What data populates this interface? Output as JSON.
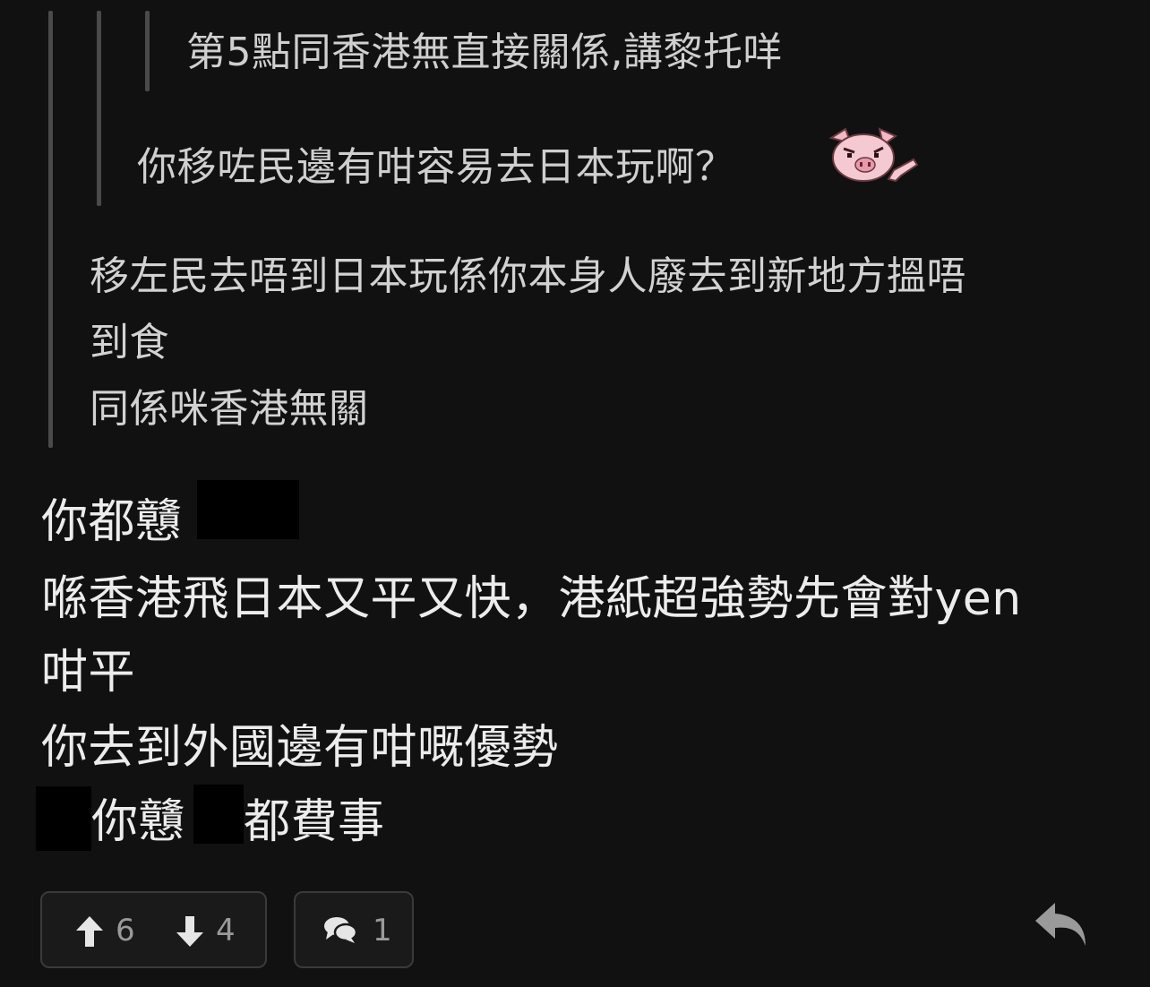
{
  "quotes": {
    "level3_text": "第5點同香港無直接關係,講黎托咩",
    "level2_text": "你移咗民邊有咁容易去日本玩啊？",
    "level2_sticker": "pig-sticker",
    "level1_lines": [
      "移左民去唔到日本玩係你本身人廢去到新地方搵唔",
      "到食",
      "同係咪香港無關"
    ]
  },
  "reply": {
    "line1_prefix": "你都戇",
    "line2": "喺香港飛日本又平又快，港紙超強勢先會對yen",
    "line3": "咁平",
    "line4": "你去到外國邊有咁嘅優勢",
    "line5_part1": "你戇",
    "line5_part2": "都費事"
  },
  "actions": {
    "upvote_count": "6",
    "downvote_count": "4",
    "comment_count": "1",
    "icons": {
      "upvote": "arrow-up-icon",
      "downvote": "arrow-down-icon",
      "comment": "comment-bubbles-icon",
      "reply": "reply-arrow-icon"
    }
  },
  "colors": {
    "background": "#111111",
    "quote_bar": "#4a4a4a",
    "redaction": "#000000"
  }
}
